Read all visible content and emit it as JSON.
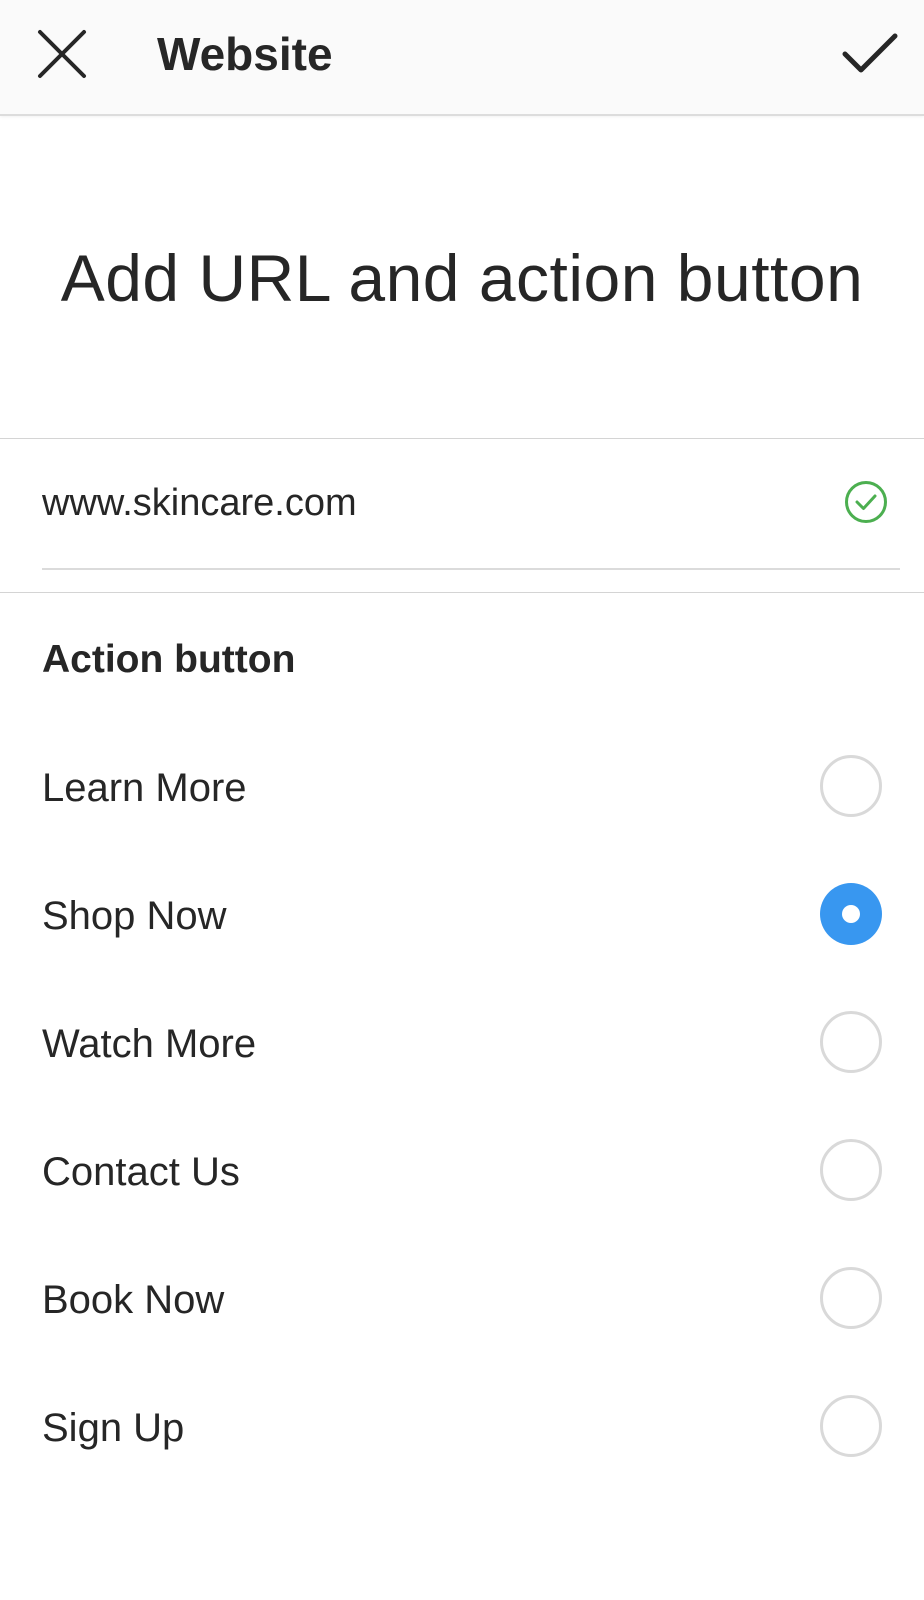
{
  "app_bar": {
    "title": "Website",
    "close_icon": "close-icon",
    "done_icon": "checkmark-icon"
  },
  "heading": "Add URL and action button",
  "url_field": {
    "value": "www.skincare.com",
    "status_icon": "check-circle-icon",
    "status_color": "#4caf50"
  },
  "action_section": {
    "label": "Action button",
    "options": [
      {
        "label": "Learn More",
        "selected": false
      },
      {
        "label": "Shop Now",
        "selected": true
      },
      {
        "label": "Watch More",
        "selected": false
      },
      {
        "label": "Contact Us",
        "selected": false
      },
      {
        "label": "Book Now",
        "selected": false
      },
      {
        "label": "Sign Up",
        "selected": false
      }
    ]
  },
  "colors": {
    "accent": "#3897f0",
    "text": "#262626",
    "divider": "#d4d4d4",
    "valid": "#4caf50"
  }
}
